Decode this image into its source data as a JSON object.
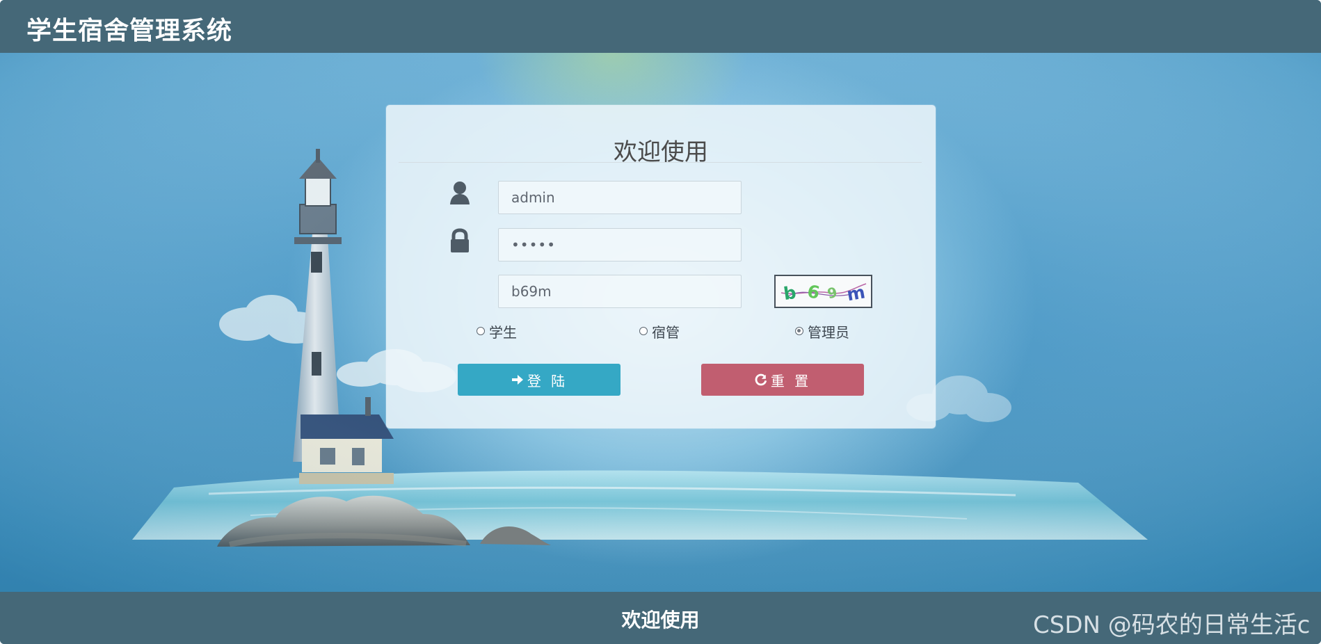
{
  "header": {
    "title": "学生宿舍管理系统"
  },
  "login": {
    "title": "欢迎使用",
    "username": {
      "value": "admin"
    },
    "password": {
      "value": "•••••"
    },
    "captcha": {
      "input_value": "b69m",
      "image_text": "b69m"
    },
    "roles": [
      {
        "label": "学生",
        "selected": false
      },
      {
        "label": "宿管",
        "selected": false
      },
      {
        "label": "管理员",
        "selected": true
      }
    ],
    "buttons": {
      "login_label": "登 陆",
      "reset_label": "重 置"
    }
  },
  "footer": {
    "title": "欢迎使用"
  },
  "watermark": "CSDN @码农的日常生活c",
  "icons": {
    "user": "user-icon",
    "lock": "lock-icon",
    "login": "arrow-right-icon",
    "reset": "refresh-icon"
  },
  "colors": {
    "header_footer": "#456878",
    "login_button": "#35a8c5",
    "reset_button": "#c15e70",
    "panel": "#eef6fa",
    "icon": "#4e5b66"
  }
}
